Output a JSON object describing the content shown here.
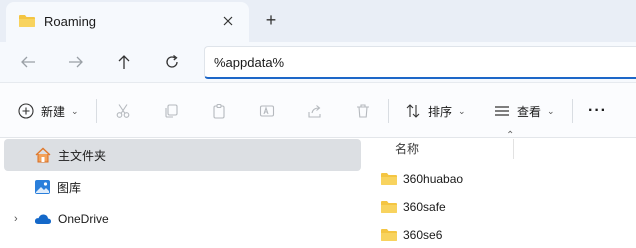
{
  "window": {
    "tab_title": "Roaming",
    "new_tab_symbol": "+"
  },
  "address_bar": {
    "value": "%appdata%"
  },
  "command_bar": {
    "new_label": "新建",
    "sort_label": "排序",
    "view_label": "查看",
    "more_symbol": "···"
  },
  "nav_pane": {
    "items": [
      {
        "label": "主文件夹",
        "icon": "home-icon",
        "selected": true
      },
      {
        "label": "图库",
        "icon": "gallery-icon",
        "selected": false
      },
      {
        "label": "OneDrive",
        "icon": "cloud-icon",
        "selected": false,
        "expandable": true
      }
    ]
  },
  "file_list": {
    "column_name": "名称",
    "items": [
      {
        "name": "360huabao",
        "icon": "folder-icon"
      },
      {
        "name": "360safe",
        "icon": "folder-icon"
      },
      {
        "name": "360se6",
        "icon": "folder-icon"
      }
    ]
  },
  "colors": {
    "folder_yellow": "#f4c542",
    "accent_blue": "#1d67c8",
    "tabbar_bg": "#e9eef6",
    "selection_bg": "#dcdfe3"
  }
}
